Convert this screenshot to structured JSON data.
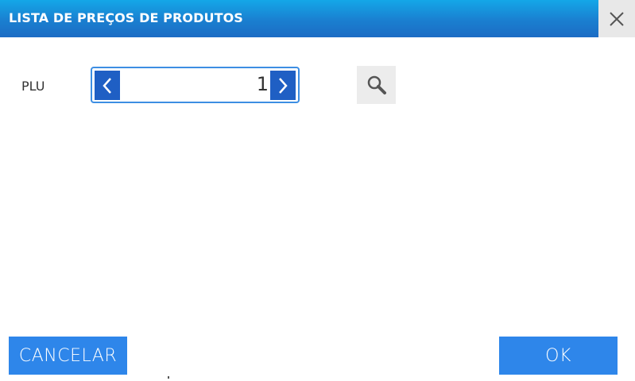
{
  "dialog": {
    "title": "LISTA DE PREÇOS DE PRODUTOS",
    "close_icon": "close-icon"
  },
  "plu": {
    "label": "PLU",
    "value": "1",
    "prev_icon": "chevron-left-icon",
    "next_icon": "chevron-right-icon"
  },
  "search": {
    "icon": "search-icon"
  },
  "actions": {
    "cancel_label": "CANCELAR",
    "ok_label": "OK"
  },
  "colors": {
    "title_bar": "#1a7fd0",
    "button_blue": "#2e86ea",
    "stepper_button": "#1f5fc4",
    "stepper_border": "#3d8ee3"
  }
}
